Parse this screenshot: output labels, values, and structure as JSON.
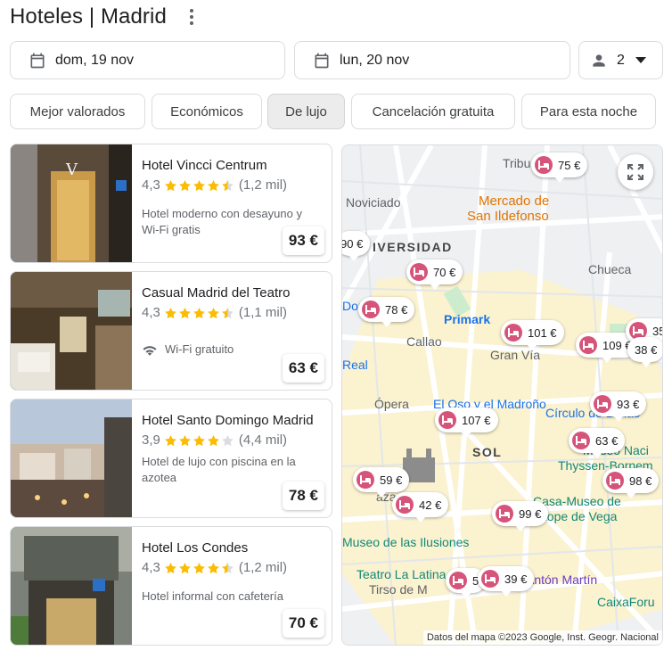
{
  "header": {
    "title": "Hoteles | Madrid"
  },
  "search": {
    "check_in": "dom, 19 nov",
    "check_out": "lun, 20 nov",
    "guests": "2"
  },
  "filters": [
    {
      "label": "Mejor valorados"
    },
    {
      "label": "Económicos"
    },
    {
      "label": "De lujo",
      "active": true
    },
    {
      "label": "Cancelación gratuita"
    },
    {
      "label": "Para esta noche"
    }
  ],
  "hotels": [
    {
      "name": "Hotel Vincci Centrum",
      "rating": "4,3",
      "reviews": "(1,2 mil)",
      "stars": 4.5,
      "description": "Hotel moderno con desayuno y Wi-Fi gratis",
      "price": "93 €"
    },
    {
      "name": "Casual Madrid del Teatro",
      "rating": "4,3",
      "reviews": "(1,1 mil)",
      "stars": 4.5,
      "amenity": "Wi-Fi gratuito",
      "price": "63 €"
    },
    {
      "name": "Hotel Santo Domingo Madrid",
      "rating": "3,9",
      "reviews": "(4,4 mil)",
      "stars": 4,
      "description": "Hotel de lujo con piscina en la azotea",
      "price": "78 €"
    },
    {
      "name": "Hotel Los Condes",
      "rating": "4,3",
      "reviews": "(1,2 mil)",
      "stars": 4.5,
      "description": "Hotel informal con cafetería",
      "price": "70 €"
    }
  ],
  "map": {
    "labels": [
      {
        "text": "Tribu",
        "style": ""
      },
      {
        "text": "Noviciado",
        "style": ""
      },
      {
        "text": "Mercado de",
        "style": "orange"
      },
      {
        "text": "San Ildefonso",
        "style": "orange"
      },
      {
        "text": "IVERSIDAD",
        "style": "bold"
      },
      {
        "text": "Chueca",
        "style": ""
      },
      {
        "text": "Dor",
        "style": "blue"
      },
      {
        "text": "Primark",
        "style": "blue"
      },
      {
        "text": "Callao",
        "style": ""
      },
      {
        "text": "Gran Vía",
        "style": ""
      },
      {
        "text": "Real",
        "style": "blue"
      },
      {
        "text": "Ópera",
        "style": ""
      },
      {
        "text": "El Oso y el Madroño",
        "style": "blue"
      },
      {
        "text": "Círculo de Bellas",
        "style": "blue"
      },
      {
        "text": "SOL",
        "style": "bold"
      },
      {
        "text": "Museo Naci",
        "style": "teal"
      },
      {
        "text": "Thyssen-Bornem",
        "style": "teal"
      },
      {
        "text": "aza Mayor",
        "style": ""
      },
      {
        "text": "Casa-Museo de",
        "style": "teal"
      },
      {
        "text": "Lope de Vega",
        "style": "teal"
      },
      {
        "text": "Museo de las Ilusiones",
        "style": "teal"
      },
      {
        "text": "Teatro La Latina",
        "style": "teal"
      },
      {
        "text": "Tirso de M",
        "style": ""
      },
      {
        "text": "Antón Martín",
        "style": ""
      },
      {
        "text": "CaixaForu",
        "style": "teal"
      }
    ],
    "pins": [
      "75 €",
      "90 €",
      "70 €",
      "78 €",
      "101 €",
      "109 €",
      "35",
      "38 €",
      "93 €",
      "107 €",
      "63 €",
      "59 €",
      "42 €",
      "98 €",
      "99 €",
      "5",
      "39 €"
    ],
    "attribution": "Datos del mapa ©2023 Google, Inst. Geogr. Nacional"
  },
  "colors": {
    "star": "#fbbc04",
    "star_empty": "#dadce0",
    "pin_icon": "#d6547a"
  }
}
